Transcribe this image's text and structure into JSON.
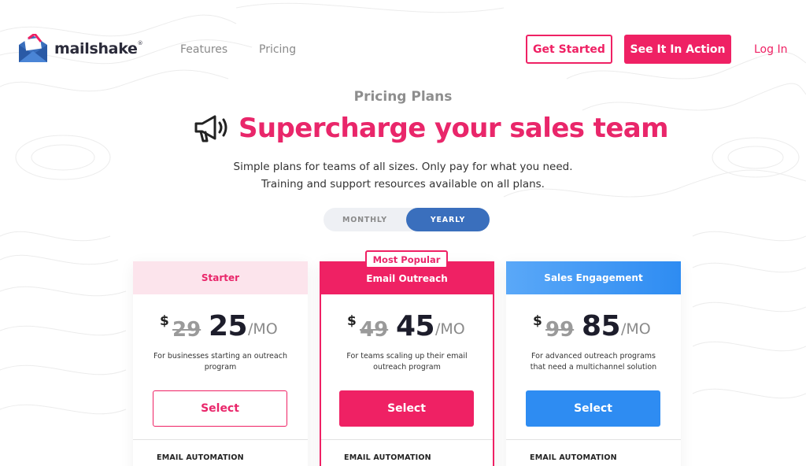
{
  "brand": {
    "name": "mailshake",
    "trademark": "®",
    "colors": {
      "primary": "#ef2164",
      "blue": "#2e8cf2",
      "toggle_active": "#3a6fbd"
    }
  },
  "nav": {
    "links": [
      "Features",
      "Pricing"
    ],
    "get_started": "Get Started",
    "see_it": "See It In Action",
    "login": "Log In"
  },
  "hero": {
    "eyebrow": "Pricing Plans",
    "icon": "megaphone-icon",
    "title": "Supercharge your sales team",
    "sub1": "Simple plans for teams of all sizes. Only pay for what you need.",
    "sub2": "Training and support resources available on all plans."
  },
  "billing_toggle": {
    "options": [
      "MONTHLY",
      "YEARLY"
    ],
    "selected": "YEARLY"
  },
  "plans": [
    {
      "name": "Starter",
      "currency": "$",
      "old_price": "29",
      "price": "25",
      "period": "/MO",
      "desc": "For businesses starting an outreach program",
      "cta": "Select",
      "feature_heading": "EMAIL AUTOMATION"
    },
    {
      "name": "Email Outreach",
      "badge": "Most Popular",
      "currency": "$",
      "old_price": "49",
      "price": "45",
      "period": "/MO",
      "desc": "For teams scaling up their email outreach program",
      "cta": "Select",
      "feature_heading": "EMAIL AUTOMATION"
    },
    {
      "name": "Sales Engagement",
      "currency": "$",
      "old_price": "99",
      "price": "85",
      "period": "/MO",
      "desc": "For advanced outreach programs that need a multichannel solution",
      "cta": "Select",
      "feature_heading": "EMAIL AUTOMATION"
    }
  ]
}
